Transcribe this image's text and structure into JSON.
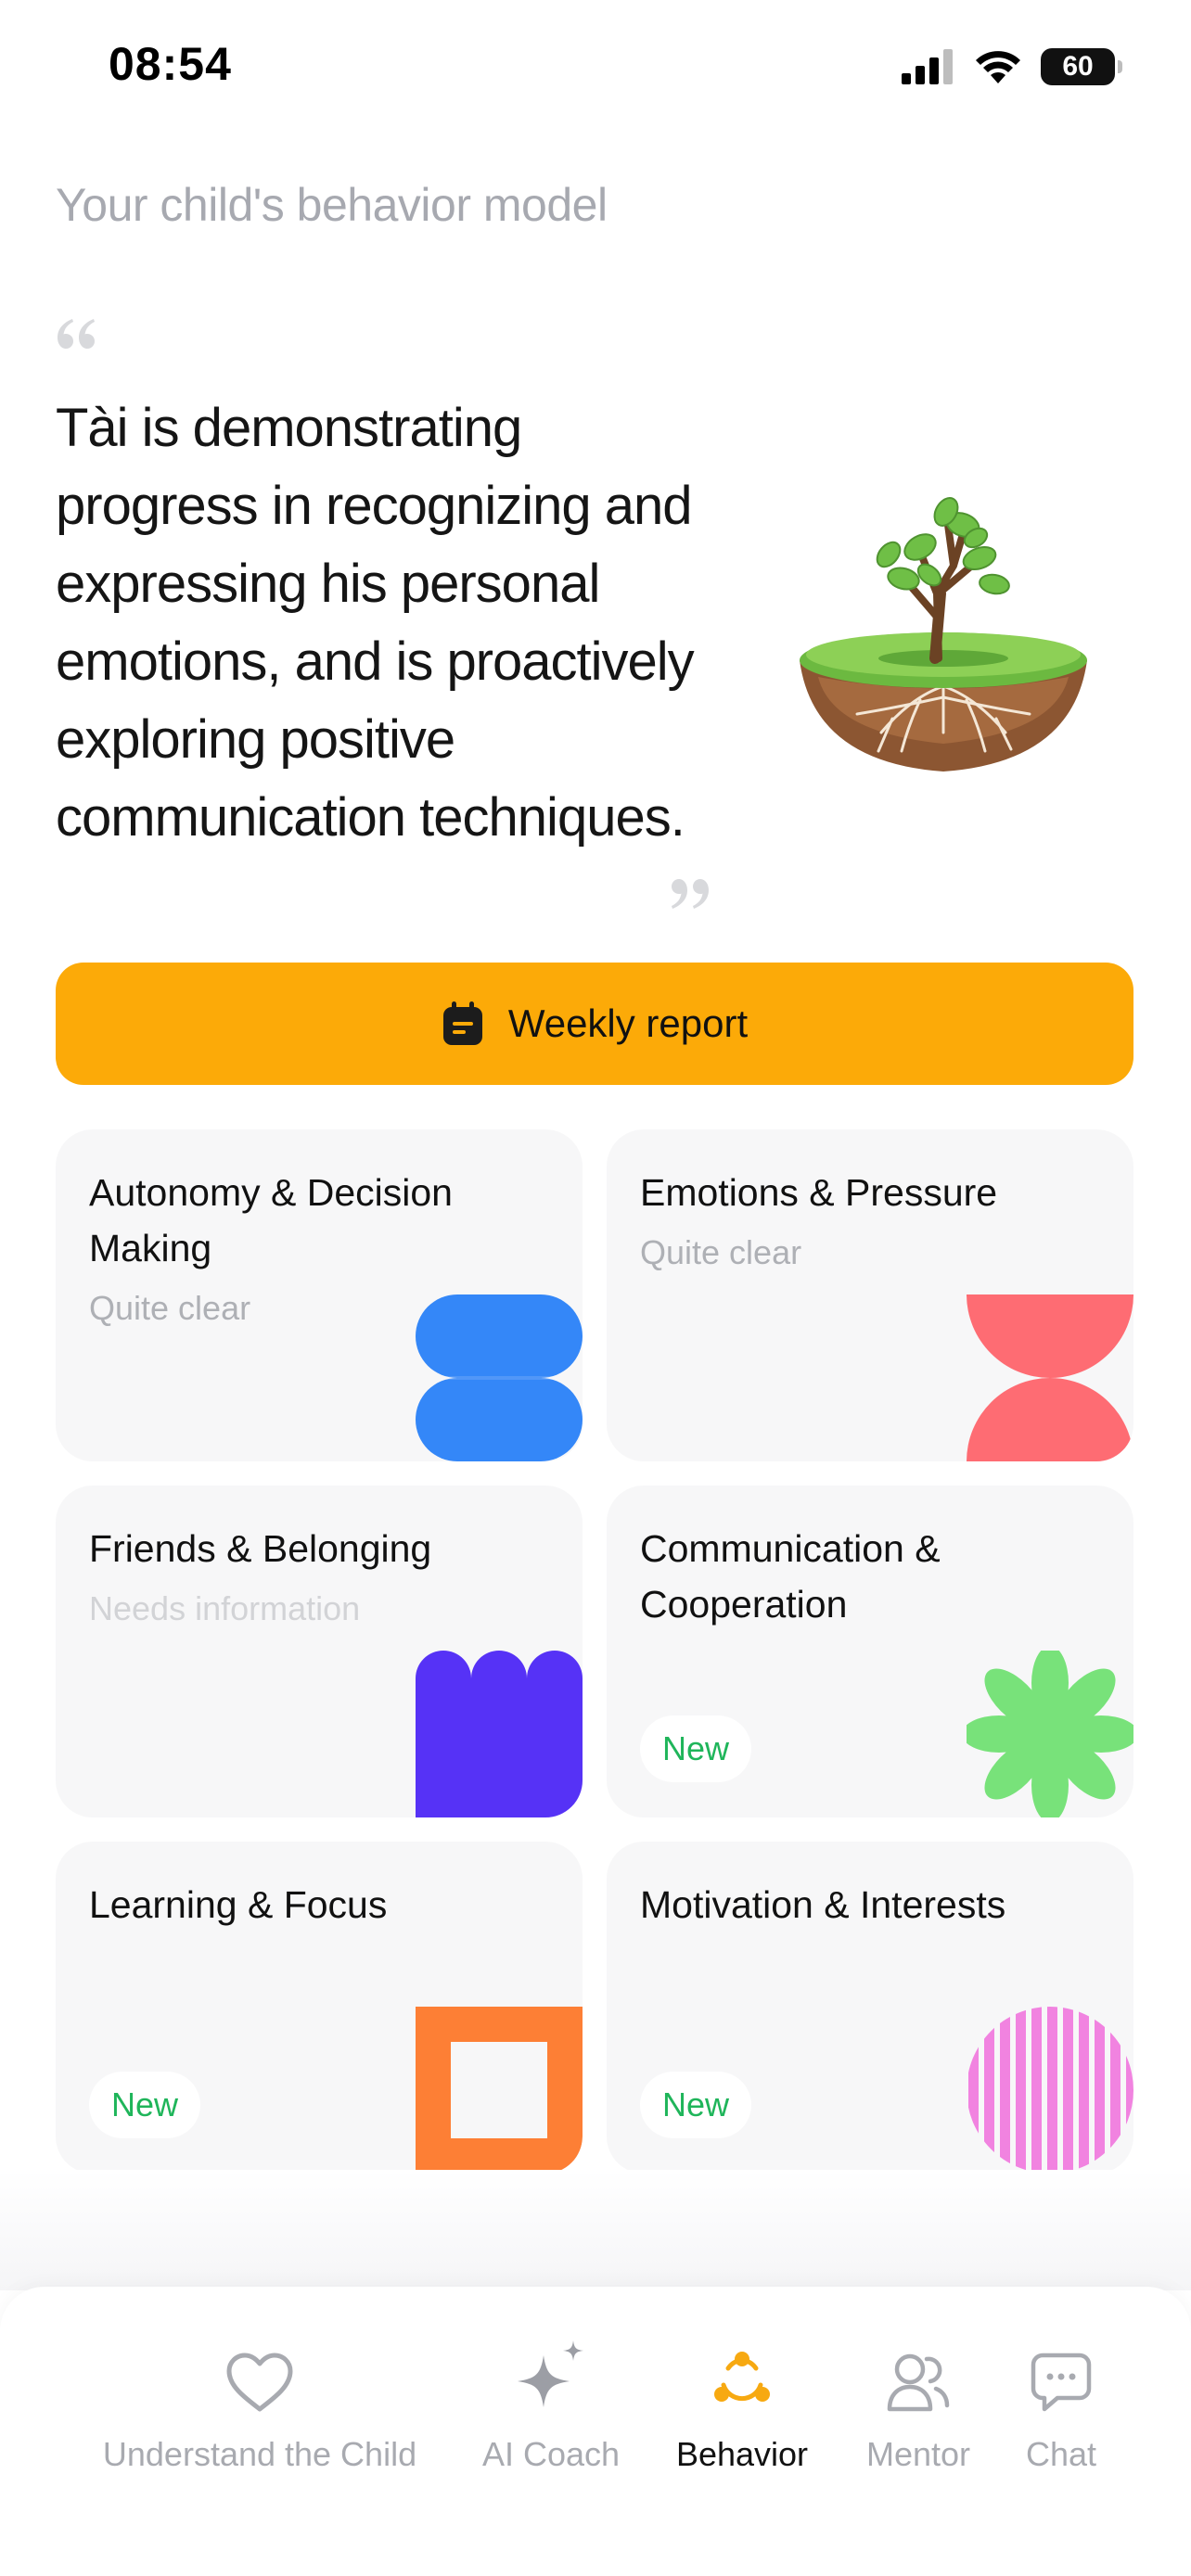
{
  "status_bar": {
    "time": "08:54",
    "battery": "60"
  },
  "header": {
    "title": "Your child's behavior model"
  },
  "summary": {
    "quote": "Tài is demonstrating progress in recognizing and expressing his personal emotions, and is proactively exploring positive communication techniques."
  },
  "weekly_report": {
    "label": "Weekly report",
    "color": "#fcaa08"
  },
  "cards": [
    {
      "title": "Autonomy & Decision Making",
      "status": "Quite clear",
      "shape_color": "#3487f8"
    },
    {
      "title": "Emotions & Pressure",
      "status": "Quite clear",
      "shape_color": "#fe6c73"
    },
    {
      "title": "Friends & Belonging",
      "status": "Needs information",
      "shape_color": "#5632f6"
    },
    {
      "title": "Communication & Cooperation",
      "badge": "New",
      "shape_color": "#78e27a"
    },
    {
      "title": "Learning & Focus",
      "badge": "New",
      "shape_color": "#fd7f35"
    },
    {
      "title": "Motivation & Interests",
      "badge": "New",
      "shape_color": "#f183e0"
    }
  ],
  "bottom_nav": {
    "items": [
      {
        "label": "Understand the Child",
        "icon": "heart-icon"
      },
      {
        "label": "AI Coach",
        "icon": "sparkle-icon"
      },
      {
        "label": "Behavior",
        "icon": "behavior-icon",
        "active": true
      },
      {
        "label": "Mentor",
        "icon": "people-icon"
      },
      {
        "label": "Chat",
        "icon": "chat-icon"
      }
    ],
    "active_color": "#f7a911",
    "inactive_color": "#a8aab0"
  }
}
